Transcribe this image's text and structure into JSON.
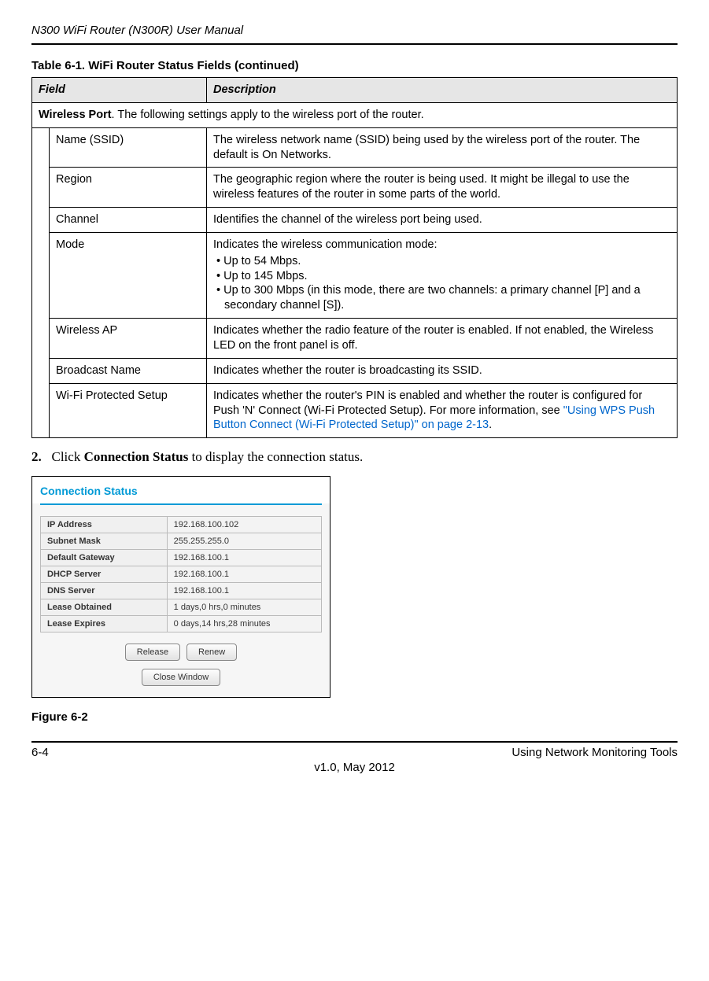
{
  "header": {
    "title": "N300 WiFi Router (N300R) User Manual"
  },
  "table": {
    "caption": "Table 6-1. WiFi Router Status Fields (continued)",
    "head_field": "Field",
    "head_desc": "Description",
    "section_title_prefix": "Wireless Port",
    "section_title_rest": ". The following settings apply to the wireless port of the router.",
    "rows": [
      {
        "field": "Name (SSID)",
        "desc": "The wireless network name (SSID) being used by the wireless port of the router. The default is On Networks."
      },
      {
        "field": "Region",
        "desc": "The geographic region where the router is being used. It might be illegal to use the wireless features of the router in some parts of the world."
      },
      {
        "field": "Channel",
        "desc": "Identifies the channel of the wireless port being used."
      },
      {
        "field": "Mode",
        "desc_intro": "Indicates the wireless communication mode:",
        "bullets": [
          "Up to 54 Mbps.",
          "Up to 145 Mbps.",
          "Up to 300 Mbps (in this mode, there are two channels: a primary channel [P] and a secondary channel [S])."
        ]
      },
      {
        "field": "Wireless AP",
        "desc": "Indicates whether the radio feature of the router is enabled. If not enabled, the Wireless LED on the front panel is off."
      },
      {
        "field": "Broadcast Name",
        "desc": "Indicates whether the router is broadcasting its SSID."
      },
      {
        "field": "Wi-Fi Protected Setup",
        "desc_pre": "Indicates whether the router's PIN is enabled and whether the router is configured for Push 'N' Connect (Wi-Fi Protected Setup). For more information, see ",
        "link": "\"Using WPS Push Button Connect (Wi-Fi Protected Setup)\" on page 2-13",
        "desc_post": "."
      }
    ]
  },
  "step": {
    "num": "2.",
    "pre": "Click ",
    "bold": "Connection Status",
    "post": " to display the connection status."
  },
  "cs": {
    "title": "Connection Status",
    "rows": [
      {
        "label": "IP Address",
        "value": "192.168.100.102"
      },
      {
        "label": "Subnet Mask",
        "value": "255.255.255.0"
      },
      {
        "label": "Default Gateway",
        "value": "192.168.100.1"
      },
      {
        "label": "DHCP Server",
        "value": "192.168.100.1"
      },
      {
        "label": "DNS Server",
        "value": "192.168.100.1"
      },
      {
        "label": "Lease Obtained",
        "value": "1 days,0 hrs,0 minutes"
      },
      {
        "label": "Lease Expires",
        "value": "0 days,14 hrs,28 minutes"
      }
    ],
    "buttons": {
      "release": "Release",
      "renew": "Renew",
      "close": "Close Window"
    }
  },
  "figure_caption": "Figure 6-2",
  "footer": {
    "left": "6-4",
    "right": "Using Network Monitoring Tools",
    "center": "v1.0, May 2012"
  }
}
